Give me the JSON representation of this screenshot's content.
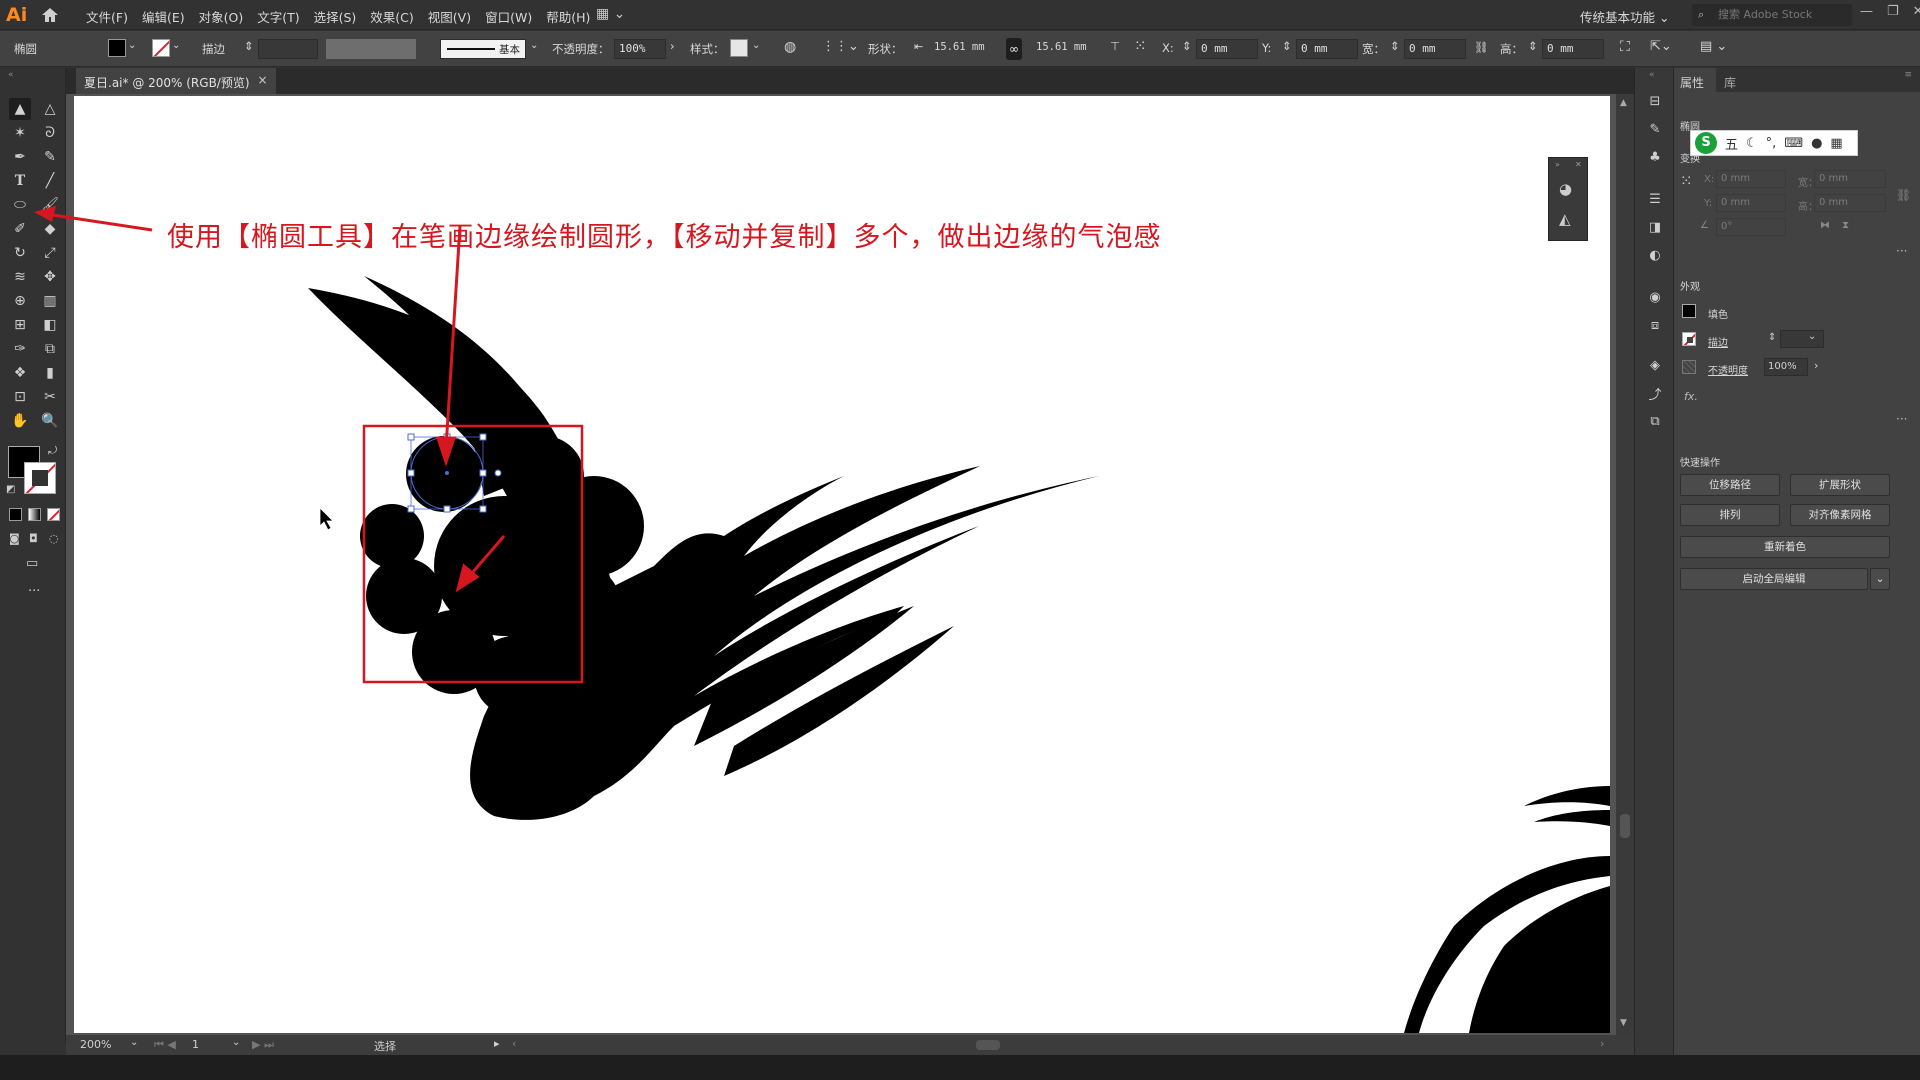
{
  "app": {
    "logo": "Ai",
    "menus": [
      "文件(F)",
      "编辑(E)",
      "对象(O)",
      "文字(T)",
      "选择(S)",
      "效果(C)",
      "视图(V)",
      "窗口(W)",
      "帮助(H)"
    ],
    "workspace": "传统基本功能",
    "search_placeholder": "搜索 Adobe Stock",
    "accent": "#ff8a1c"
  },
  "controlbar": {
    "object_type": "椭圆",
    "stroke_label": "描边",
    "stroke_profile": "基本",
    "opacity_label": "不透明度：",
    "opacity_value": "100%",
    "style_label": "样式：",
    "shape_label": "形状：",
    "width_value": "15.61 mm",
    "height_value": "15.61 mm",
    "x_label": "X:",
    "x_value": "0 mm",
    "y_label": "Y:",
    "y_value": "0 mm",
    "w_label": "宽：",
    "w_value": "0 mm",
    "h_label": "高：",
    "h_value": "0 mm"
  },
  "document": {
    "tab_title": "夏日.ai* @ 200% (RGB/预览)",
    "close": "×"
  },
  "annotation": {
    "text": "使用【椭圆工具】在笔画边缘绘制圆形，【移动并复制】多个，做出边缘的气泡感",
    "color": "#d7171f"
  },
  "statusbar": {
    "zoom": "200%",
    "page": "1",
    "mode": "选择"
  },
  "properties": {
    "tabs": [
      "属性",
      "库"
    ],
    "object_type": "椭圆",
    "transform_label": "变换",
    "x_label": "X:",
    "x_value": "0 mm",
    "y_label": "Y:",
    "y_value": "0 mm",
    "w_label": "宽：",
    "w_value": "0 mm",
    "h_label": "高：",
    "h_value": "0 mm",
    "angle_value": "0°",
    "appearance_label": "外观",
    "fill_label": "填色",
    "stroke_label": "描边",
    "opacity_label": "不透明度",
    "opacity_value": "100%",
    "fx_label": "fx.",
    "quick_actions_label": "快速操作",
    "buttons": [
      "位移路径",
      "扩展形状",
      "排列",
      "对齐像素网格",
      "重新着色",
      "启动全局编辑"
    ]
  },
  "ime": {
    "logo": "S",
    "mode": "五"
  }
}
